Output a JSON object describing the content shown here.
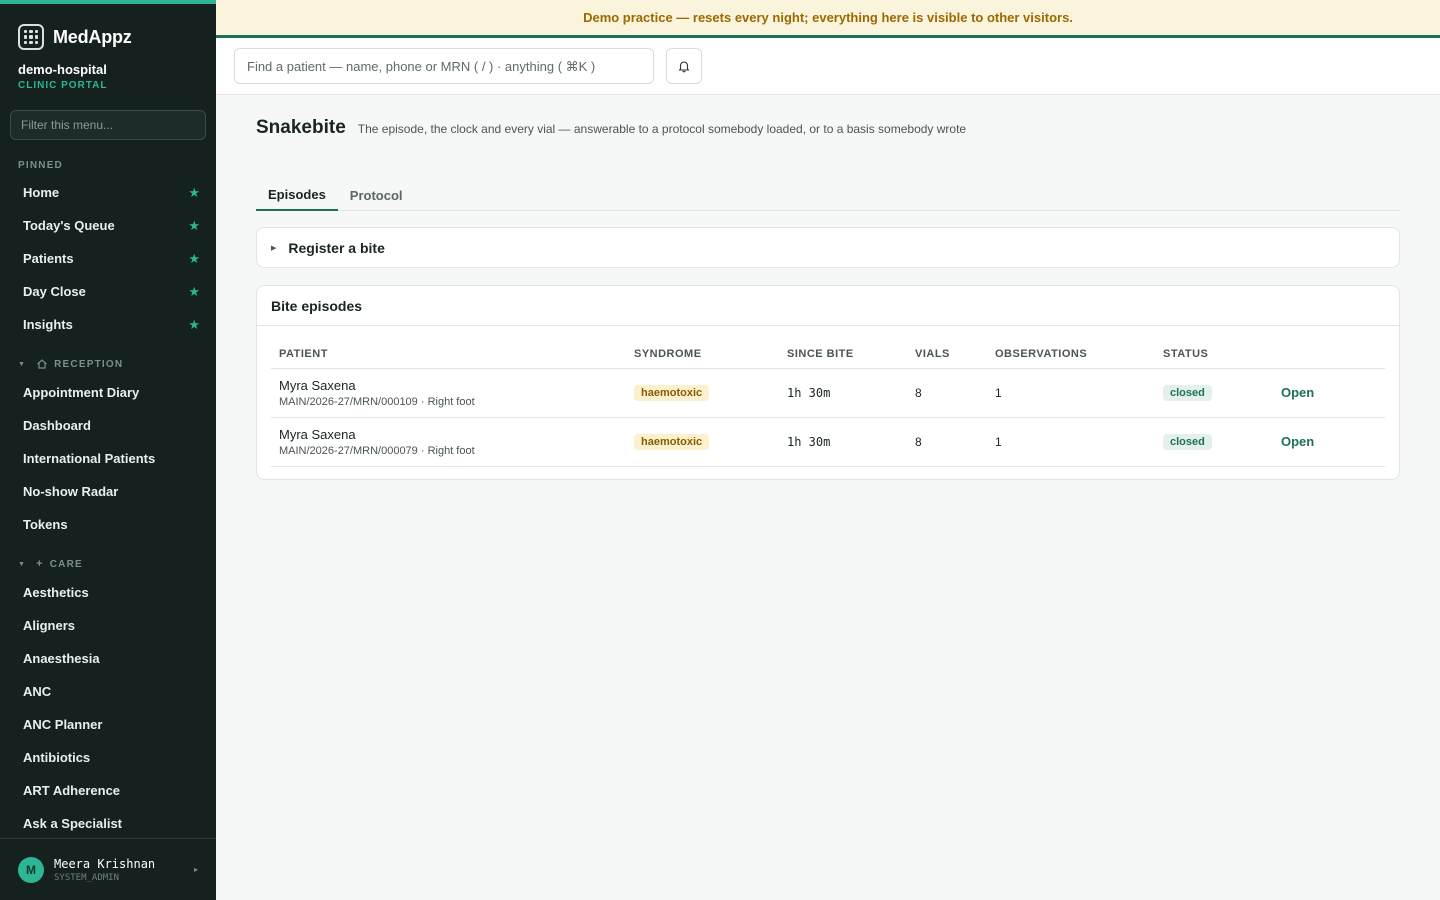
{
  "brand": {
    "name": "MedAppz"
  },
  "org": {
    "name": "demo-hospital",
    "sub": "CLINIC PORTAL"
  },
  "menu_filter": {
    "placeholder": "Filter this menu..."
  },
  "pinned": {
    "label": "PINNED",
    "items": [
      {
        "label": "Home"
      },
      {
        "label": "Today's Queue"
      },
      {
        "label": "Patients"
      },
      {
        "label": "Day Close"
      },
      {
        "label": "Insights"
      }
    ]
  },
  "groups": {
    "reception": {
      "label": "RECEPTION",
      "items": [
        {
          "label": "Appointment Diary"
        },
        {
          "label": "Dashboard"
        },
        {
          "label": "International Patients"
        },
        {
          "label": "No-show Radar"
        },
        {
          "label": "Tokens"
        }
      ]
    },
    "care": {
      "label": "CARE",
      "items": [
        {
          "label": "Aesthetics"
        },
        {
          "label": "Aligners"
        },
        {
          "label": "Anaesthesia"
        },
        {
          "label": "ANC"
        },
        {
          "label": "ANC Planner"
        },
        {
          "label": "Antibiotics"
        },
        {
          "label": "ART Adherence"
        },
        {
          "label": "Ask a Specialist"
        }
      ]
    }
  },
  "user": {
    "initial": "M",
    "name": "Meera Krishnan",
    "role": "SYSTEM_ADMIN"
  },
  "banner": {
    "text": "Demo practice — resets every night; everything here is visible to other visitors."
  },
  "search": {
    "placeholder": "Find a patient — name, phone or MRN ( / ) · anything ( ⌘K )"
  },
  "page": {
    "title": "Snakebite",
    "subtitle": "The episode, the clock and every vial — answerable to a protocol somebody loaded, or to a basis somebody wrote"
  },
  "tabs": [
    {
      "label": "Episodes",
      "active": true
    },
    {
      "label": "Protocol",
      "active": false
    }
  ],
  "register": {
    "label": "Register a bite"
  },
  "episodes": {
    "title": "Bite episodes",
    "columns": [
      "PATIENT",
      "SYNDROME",
      "SINCE BITE",
      "VIALS",
      "OBSERVATIONS",
      "STATUS"
    ],
    "rows": [
      {
        "name": "Myra Saxena",
        "meta": "MAIN/2026-27/MRN/000109 · Right foot",
        "syndrome": "haemotoxic",
        "since": "1h 30m",
        "vials": "8",
        "observations": "1",
        "status": "closed",
        "action": "Open"
      },
      {
        "name": "Myra Saxena",
        "meta": "MAIN/2026-27/MRN/000079 · Right foot",
        "syndrome": "haemotoxic",
        "since": "1h 30m",
        "vials": "8",
        "observations": "1",
        "status": "closed",
        "action": "Open"
      }
    ]
  },
  "colors": {
    "accent": "#2db594",
    "brand_dark": "#1f6f5c",
    "sidebar_bg": "#14211f",
    "banner_bg": "#fbf4dc",
    "banner_text": "#9a6a00"
  },
  "icons": {
    "star": "star-icon",
    "bell": "bell-icon",
    "reception": "home-icon",
    "care": "plus-icon"
  }
}
